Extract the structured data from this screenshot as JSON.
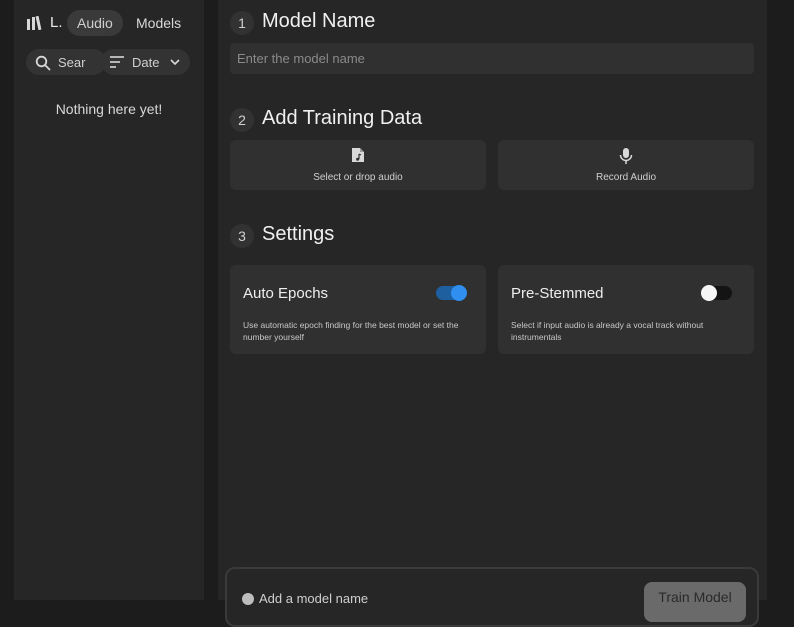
{
  "sidebar": {
    "library_label": "L.",
    "tabs": [
      {
        "label": "Audio",
        "active": true
      },
      {
        "label": "Models",
        "active": false
      }
    ],
    "search_label": "Sear",
    "sort_label": "Date",
    "empty_text": "Nothing here yet!"
  },
  "main": {
    "steps": [
      {
        "number": "1",
        "title": "Model Name"
      },
      {
        "number": "2",
        "title": "Add Training Data"
      },
      {
        "number": "3",
        "title": "Settings"
      }
    ],
    "model_name_placeholder": "Enter the model name",
    "select_audio_label": "Select or drop audio",
    "record_audio_label": "Record Audio",
    "settings": {
      "auto_epochs": {
        "title": "Auto Epochs",
        "description": "Use automatic epoch finding for the best model or set the number yourself",
        "enabled": true
      },
      "pre_stemmed": {
        "title": "Pre-Stemmed",
        "description": "Select if input audio is already a vocal track without instrumentals",
        "enabled": false
      }
    },
    "footer": {
      "hint": "Add a model name",
      "train_label": "Train Model"
    }
  },
  "colors": {
    "accent": "#2f8ef0",
    "panel": "#262626",
    "card": "#303030"
  }
}
